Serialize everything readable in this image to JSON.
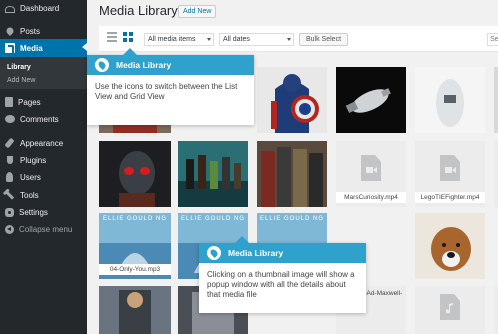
{
  "sidebar": {
    "items": [
      {
        "label": "Dashboard",
        "icon": "dashboard-icon"
      },
      {
        "label": "Posts",
        "icon": "pushpin-icon"
      },
      {
        "label": "Media",
        "icon": "media-icon",
        "current": true
      },
      {
        "label": "Pages",
        "icon": "pages-icon"
      },
      {
        "label": "Comments",
        "icon": "comment-icon"
      },
      {
        "label": "Appearance",
        "icon": "paintbrush-icon"
      },
      {
        "label": "Plugins",
        "icon": "plugin-icon"
      },
      {
        "label": "Users",
        "icon": "user-icon"
      },
      {
        "label": "Tools",
        "icon": "wrench-icon"
      },
      {
        "label": "Settings",
        "icon": "settings-icon"
      },
      {
        "label": "Collapse menu",
        "icon": "collapse-icon"
      }
    ],
    "submenu": [
      {
        "label": "Library",
        "current": true
      },
      {
        "label": "Add New"
      }
    ]
  },
  "header": {
    "title": "Media Library",
    "add_new_label": "Add New"
  },
  "toolbar": {
    "view_list_icon": "list-view-icon",
    "view_grid_icon": "grid-view-icon",
    "media_type": "All media items",
    "date_filter": "All dates",
    "bulk_select_label": "Bulk Select",
    "search_value": "Se"
  },
  "grid": {
    "row1": [
      "ironman",
      "captain-america",
      "satellite",
      "robot",
      "stormtroopers"
    ],
    "row2": [
      {
        "kind": "image",
        "subject": "starlord"
      },
      {
        "kind": "image",
        "subject": "guardians"
      },
      {
        "kind": "image",
        "subject": "heroes"
      },
      {
        "kind": "file",
        "type": "video",
        "title": "MarsCuriosity.mp4"
      },
      {
        "kind": "file",
        "type": "video",
        "title": "LegoTIEFighter.mp4"
      }
    ],
    "row3": [
      {
        "kind": "audio",
        "title": "04-Only-You.mp3",
        "art_text": "ELLIE GOULD NG"
      },
      {
        "kind": "audio",
        "art_text": "ELLIE GOULD NG"
      },
      {
        "kind": "audio",
        "art_text": "ELLIE GOULD NG"
      },
      {
        "kind": "image",
        "subject": "dog"
      }
    ],
    "row4": [
      {
        "kind": "image",
        "subject": "thor"
      },
      {
        "kind": "image",
        "subject": "armor"
      },
      {
        "kind": "file",
        "type": "audio",
        "title": "Maddies-Ad-Maxwell-"
      }
    ]
  },
  "tooltips": {
    "views": {
      "title": "Media Library",
      "body": "Use the icons to switch between the List View and Grid View"
    },
    "thumbnail": {
      "title": "Media Library",
      "body": "Clicking on a thumbnail image will show a popup window with all the details about that media file"
    }
  },
  "colors": {
    "admin_sidebar": "#23282d",
    "accent": "#0073aa",
    "pointer_header": "#2ea2cc",
    "background": "#f1f1f1"
  }
}
